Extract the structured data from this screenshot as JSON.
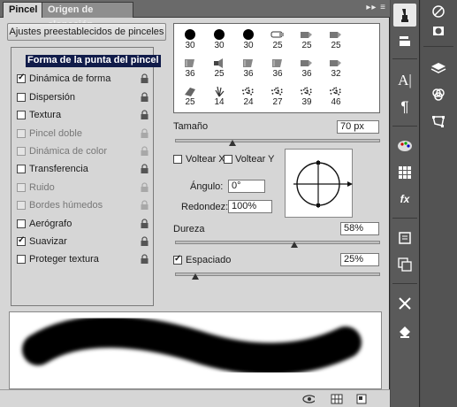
{
  "tabs": [
    {
      "label": "Pincel",
      "active": true
    },
    {
      "label": "Origen de clonación",
      "active": false
    }
  ],
  "preset_button": "Ajustes preestablecidos de pinceles",
  "options": [
    {
      "label": "Forma de la punta del pincel",
      "header": true
    },
    {
      "label": "Dinámica de forma",
      "checked": true,
      "enabled": true
    },
    {
      "label": "Dispersión",
      "checked": false,
      "enabled": true
    },
    {
      "label": "Textura",
      "checked": false,
      "enabled": true
    },
    {
      "label": "Pincel doble",
      "checked": false,
      "enabled": false
    },
    {
      "label": "Dinámica de color",
      "checked": false,
      "enabled": false
    },
    {
      "label": "Transferencia",
      "checked": false,
      "enabled": true
    },
    {
      "label": "Ruido",
      "checked": false,
      "enabled": false
    },
    {
      "label": "Bordes húmedos",
      "checked": false,
      "enabled": false
    },
    {
      "label": "Aerógrafo",
      "checked": false,
      "enabled": true
    },
    {
      "label": "Suavizar",
      "checked": true,
      "enabled": true
    },
    {
      "label": "Proteger textura",
      "checked": false,
      "enabled": true
    }
  ],
  "brush_tips": [
    {
      "size": "30",
      "shape": "hard-round"
    },
    {
      "size": "30",
      "shape": "hard-round"
    },
    {
      "size": "30",
      "shape": "hard-round"
    },
    {
      "size": "25",
      "shape": "pen"
    },
    {
      "size": "25",
      "shape": "marker"
    },
    {
      "size": "25",
      "shape": "marker"
    },
    {
      "size": "36",
      "shape": "chisel"
    },
    {
      "size": "25",
      "shape": "speaker"
    },
    {
      "size": "36",
      "shape": "chisel"
    },
    {
      "size": "36",
      "shape": "chisel"
    },
    {
      "size": "36",
      "shape": "marker"
    },
    {
      "size": "32",
      "shape": "marker"
    },
    {
      "size": "25",
      "shape": "chalk"
    },
    {
      "size": "14",
      "shape": "grass"
    },
    {
      "size": "24",
      "shape": "scatter"
    },
    {
      "size": "27",
      "shape": "scatter"
    },
    {
      "size": "39",
      "shape": "scatter"
    },
    {
      "size": "46",
      "shape": "scatter"
    }
  ],
  "tamano": {
    "label": "Tamaño",
    "value": "70 px",
    "level": 0.27
  },
  "voltear_x": {
    "label": "Voltear X",
    "checked": false
  },
  "voltear_y": {
    "label": "Voltear Y",
    "checked": false
  },
  "angulo": {
    "label": "Ángulo:",
    "value": "0°"
  },
  "redondez": {
    "label": "Redondez:",
    "value": "100%"
  },
  "dureza": {
    "label": "Dureza",
    "value": "58%",
    "level": 0.58
  },
  "espaciado": {
    "label": "Espaciado",
    "value": "25%",
    "checked": true,
    "level": 0.08
  },
  "colors": {
    "panel_bg": "#d6d6d6",
    "dock_bg": "#535353",
    "selection": "#111c4a"
  },
  "icons": {
    "mid_dock": [
      "brush-tool-icon",
      "clone-stamp-icon",
      "character-icon",
      "paragraph-icon",
      "color-palette-icon",
      "swatches-icon",
      "styles-fx-icon",
      "layer-comps-icon",
      "history-icon",
      "tools-icon",
      "actions-icon"
    ],
    "right_dock": [
      "adjustments-icon",
      "masks-icon",
      "layers-icon",
      "channels-icon",
      "paths-icon"
    ]
  }
}
